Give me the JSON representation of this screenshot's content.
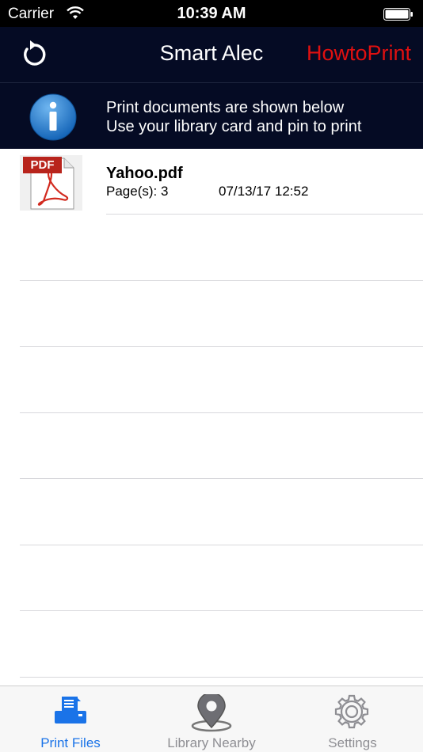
{
  "status_bar": {
    "carrier": "Carrier",
    "time": "10:39 AM"
  },
  "nav": {
    "title": "Smart Alec",
    "howto_label": "HowtoPrint"
  },
  "info_banner": {
    "line1": "Print documents are shown below",
    "line2": "Use your library card and pin to print"
  },
  "files": [
    {
      "name": "Yahoo.pdf",
      "pages": "Page(s): 3",
      "date": "07/13/17 12:52",
      "thumb_label": "PDF"
    }
  ],
  "tabs": [
    {
      "label": "Print Files",
      "active": true
    },
    {
      "label": "Library Nearby",
      "active": false
    },
    {
      "label": "Settings",
      "active": false
    }
  ],
  "colors": {
    "nav_bg": "#050b24",
    "accent": "#1a73e8",
    "howto": "#e01010",
    "inactive": "#8e8e93"
  }
}
